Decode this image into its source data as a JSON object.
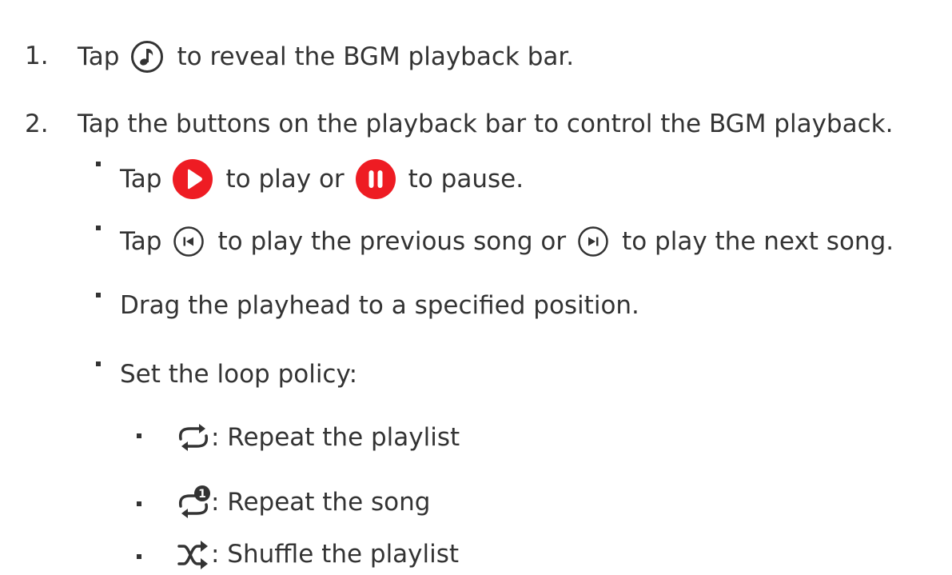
{
  "colors": {
    "text": "#333333",
    "accent": "#ee1c23",
    "icon_dark": "#333333"
  },
  "steps": [
    {
      "number": "1.",
      "before": "Tap",
      "icon": "music-note-icon",
      "after": "to reveal the BGM playback bar."
    },
    {
      "number": "2.",
      "text": "Tap the buttons on the playback bar to control the BGM playback."
    }
  ],
  "controls": {
    "play_pause": {
      "before": "Tap",
      "icon1": "play-icon",
      "middle": "to play or",
      "icon2": "pause-icon",
      "after": "to pause."
    },
    "prev_next": {
      "before": "Tap",
      "icon1": "previous-icon",
      "middle": "to play the previous song or",
      "icon2": "next-icon",
      "after": "to play the next song."
    },
    "drag": {
      "text": "Drag the playhead to a specified position."
    },
    "loop": {
      "text": "Set the loop policy:"
    }
  },
  "loop_options": [
    {
      "icon": "repeat-playlist-icon",
      "text": ": Repeat the playlist"
    },
    {
      "icon": "repeat-song-icon",
      "text": ": Repeat the song",
      "badge": "1"
    },
    {
      "icon": "shuffle-icon",
      "text": ": Shuffle the playlist"
    }
  ]
}
